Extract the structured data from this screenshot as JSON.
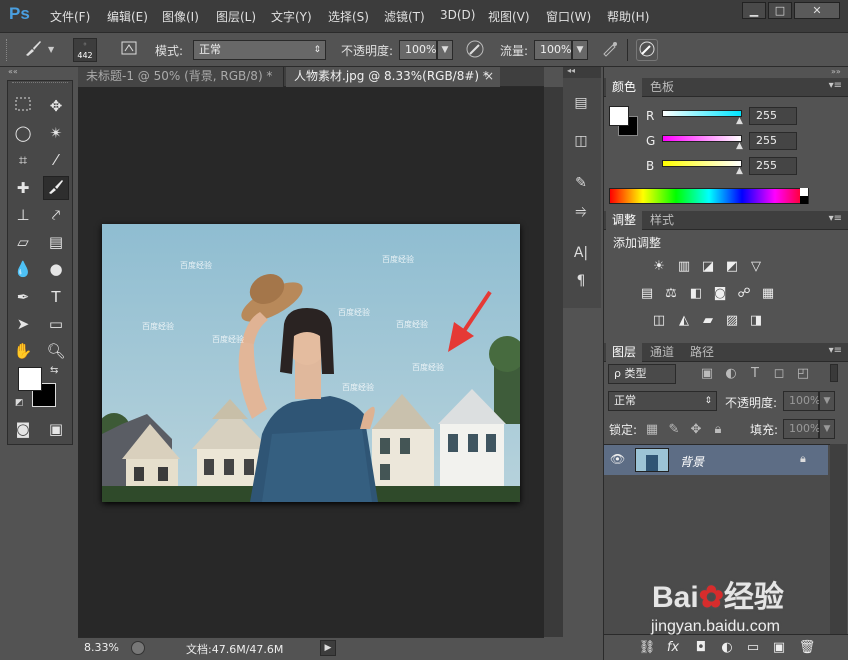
{
  "app": {
    "logo": "Ps"
  },
  "menu": [
    "文件(F)",
    "编辑(E)",
    "图像(I)",
    "图层(L)",
    "文字(Y)",
    "选择(S)",
    "滤镜(T)",
    "3D(D)",
    "视图(V)",
    "窗口(W)",
    "帮助(H)"
  ],
  "window_controls": {
    "minimize": "▁",
    "maximize": "□",
    "close": "✕"
  },
  "options": {
    "brush_size": "442",
    "mode_label": "模式:",
    "mode_value": "正常",
    "opacity_label": "不透明度:",
    "opacity_value": "100%",
    "flow_label": "流量:",
    "flow_value": "100%"
  },
  "doc_tabs": [
    {
      "label": "未标题-1 @ 50% (背景, RGB/8) *",
      "close": "×",
      "active": false
    },
    {
      "label": "人物素材.jpg @ 8.33%(RGB/8#) *",
      "close": "×",
      "active": true
    }
  ],
  "status": {
    "zoom": "8.33%",
    "doc_info": "文档:47.6M/47.6M",
    "arrow": "▶"
  },
  "color_panel": {
    "tabs": [
      "颜色",
      "色板"
    ],
    "channels": [
      {
        "label": "R",
        "value": "255"
      },
      {
        "label": "G",
        "value": "255"
      },
      {
        "label": "B",
        "value": "255"
      }
    ],
    "accent": {
      "r": "#00e5ff",
      "g": "#ff00ff",
      "b": "#ffff00"
    }
  },
  "adjust_panel": {
    "tabs": [
      "调整",
      "样式"
    ],
    "title": "添加调整",
    "row1": [
      "☀",
      "▥",
      "◪",
      "◩",
      "▽"
    ],
    "row2": [
      "▤",
      "⚖",
      "◧",
      "◙",
      "☍",
      "▦"
    ],
    "row3": [
      "◫",
      "◭",
      "▰",
      "▨",
      "◨"
    ]
  },
  "layers_panel": {
    "tabs": [
      "图层",
      "通道",
      "路径"
    ],
    "filter_label": "ρ 类型",
    "blend_mode": "正常",
    "opacity_label": "不透明度:",
    "opacity_value": "100%",
    "lock_label": "锁定:",
    "fill_label": "填充:",
    "fill_value": "100%",
    "layer_name": "背景",
    "footer_icons": [
      "⛓",
      "fx",
      "◘",
      "◐",
      "▭",
      "▣",
      "🗑"
    ]
  },
  "canvas": {
    "watermark_text": "百度经验"
  },
  "brand_watermark": {
    "brand": "Bai",
    "brand_suffix": "经验",
    "url": "jingyan.baidu.com"
  }
}
